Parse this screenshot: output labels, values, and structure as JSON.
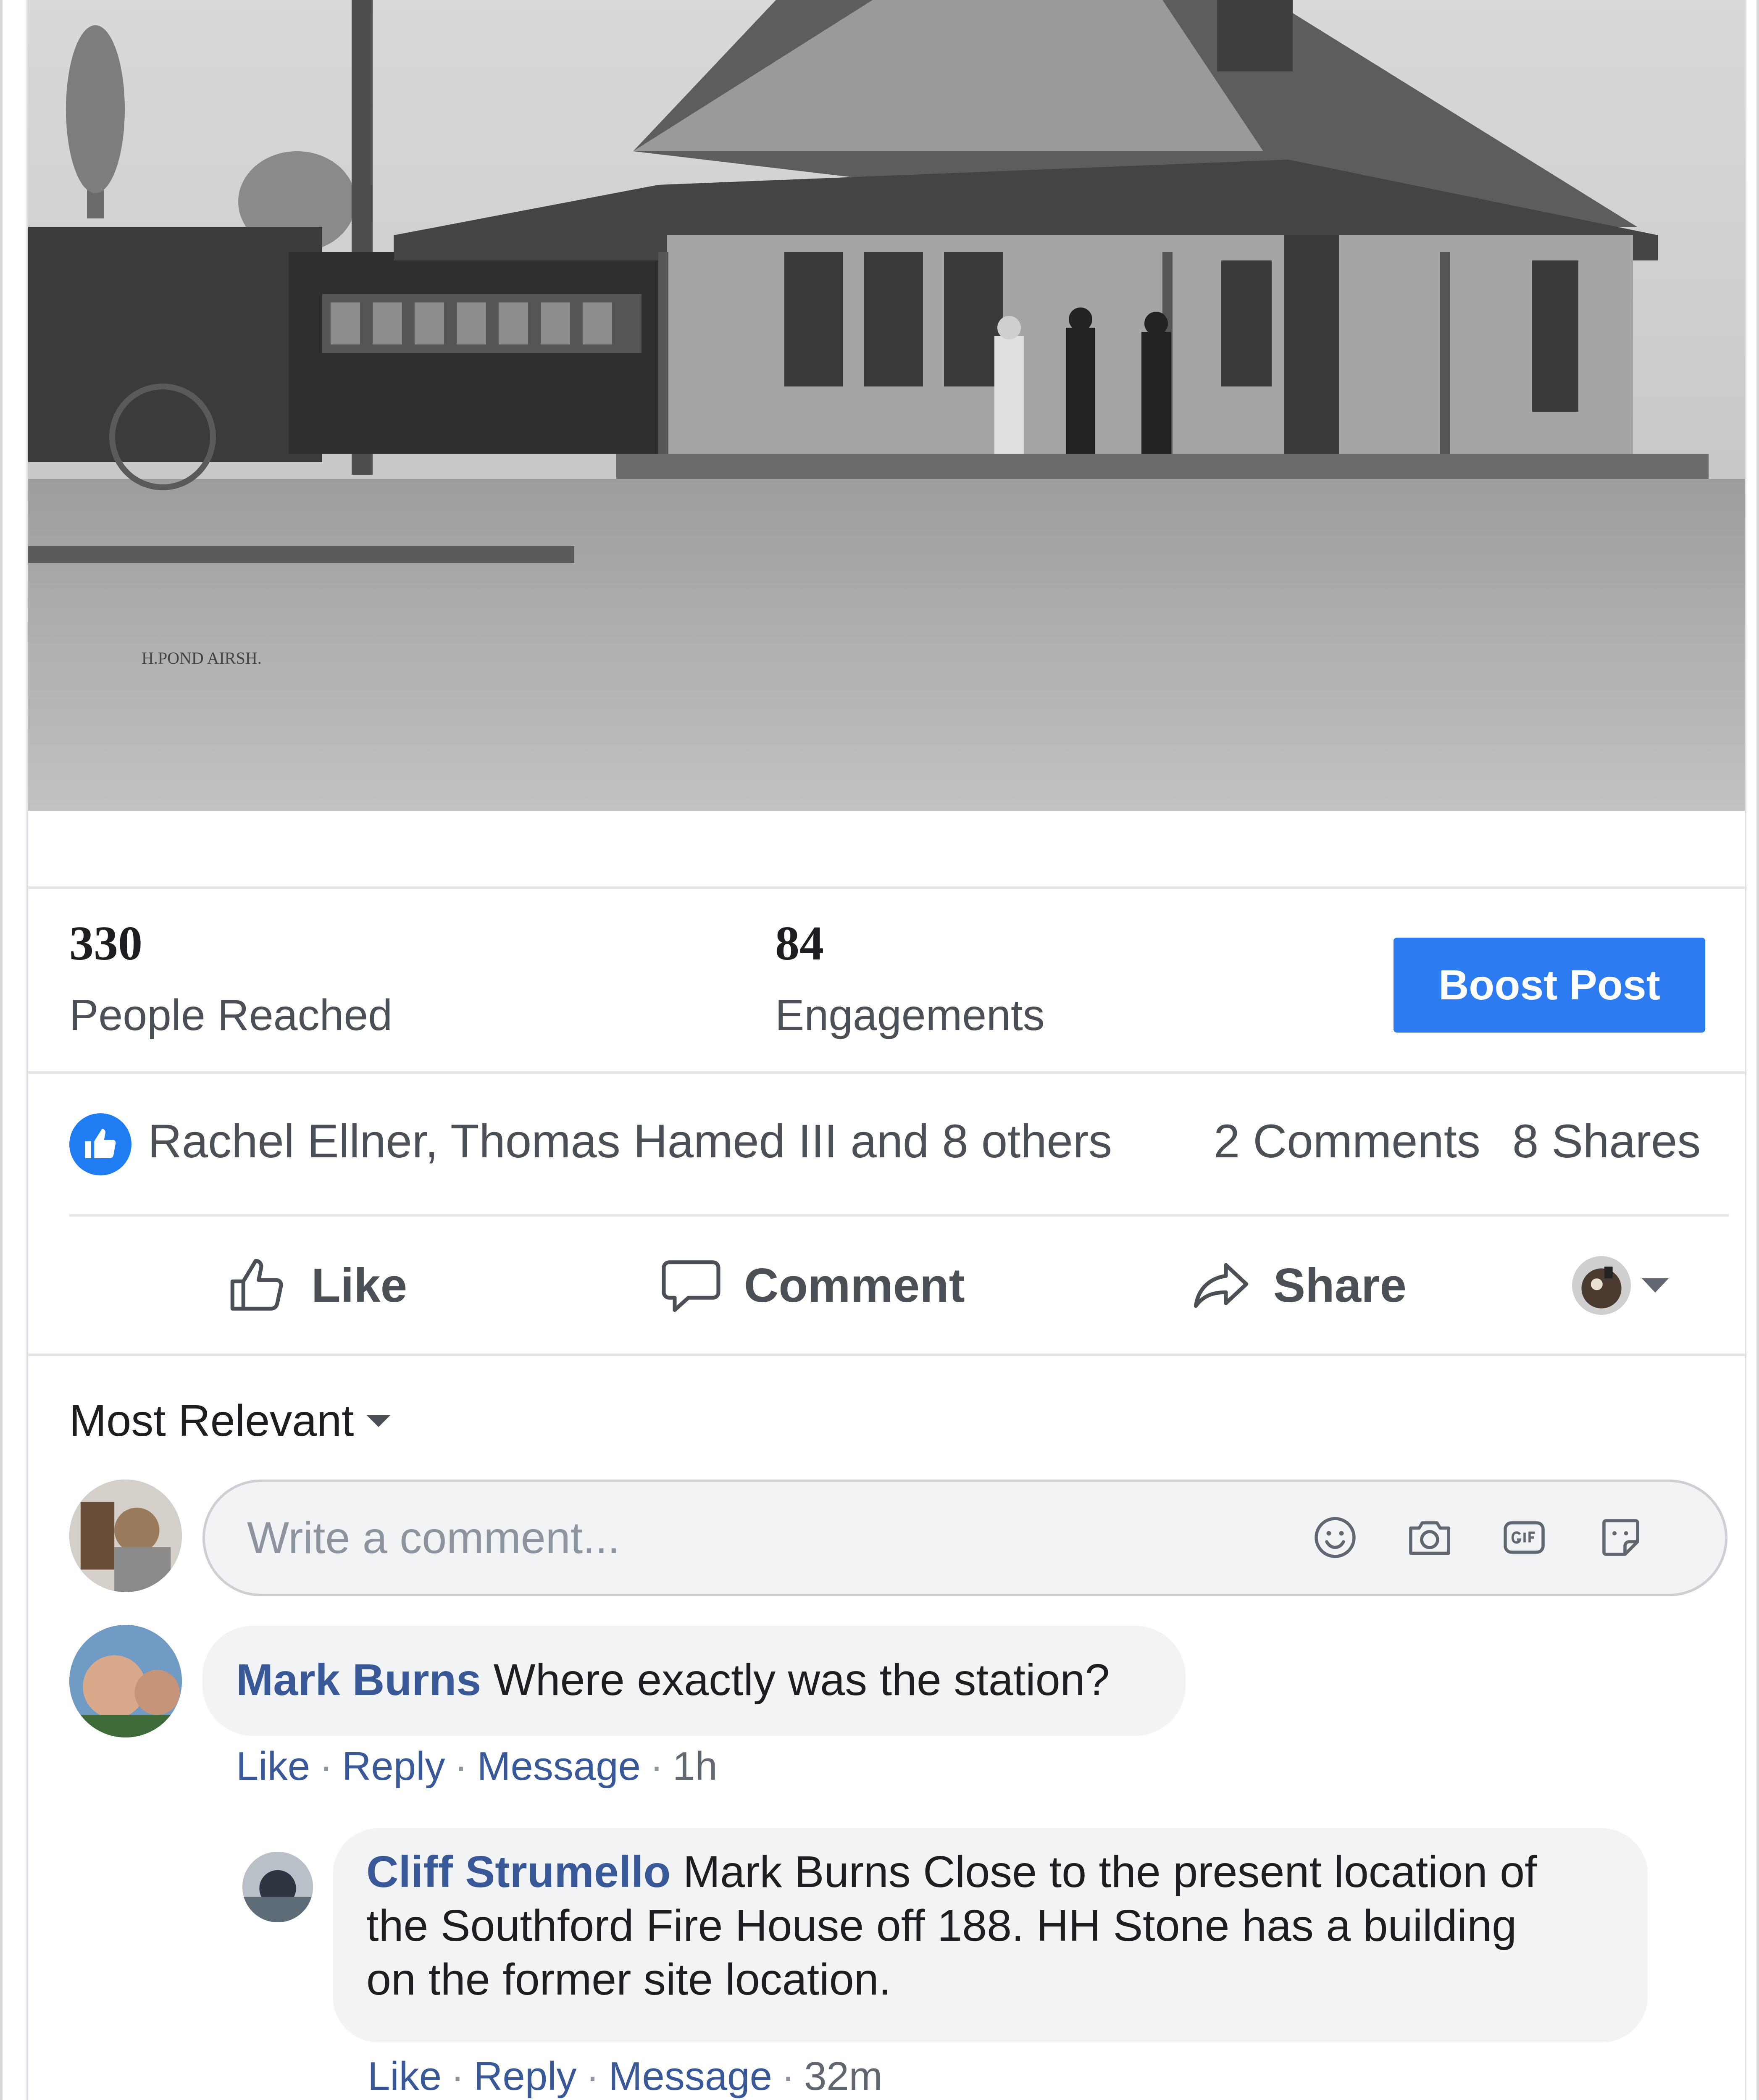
{
  "post": {
    "photo_alt": "Historic photograph of a railroad station with a trolley car and people on the platform",
    "photo_caption": "H.POND AIRSH."
  },
  "insights": {
    "reached": {
      "value": "330",
      "label": "People Reached"
    },
    "engagements": {
      "value": "84",
      "label": "Engagements"
    },
    "boost_label": "Boost Post"
  },
  "reactions": {
    "text": "Rachel Ellner, Thomas Hamed III and 8 others",
    "comments": "2 Comments",
    "shares": "8 Shares"
  },
  "actions": {
    "like": "Like",
    "comment": "Comment",
    "share": "Share"
  },
  "comments_section": {
    "sort_label": "Most Relevant",
    "input_placeholder": "Write a comment...",
    "comments": [
      {
        "author": "Mark Burns",
        "text": "Where exactly was the station?",
        "like": "Like",
        "reply": "Reply",
        "message": "Message",
        "time": "1h"
      }
    ],
    "replies": [
      {
        "author": "Cliff Strumello",
        "line1": "Mark Burns Close to the present location of",
        "line2": "the Southford Fire House off 188. HH Stone has a building",
        "line3": "on the former site location.",
        "like": "Like",
        "reply": "Reply",
        "message": "Message",
        "time": "32m"
      }
    ]
  },
  "colors": {
    "accent": "#2d7bf0",
    "link": "#385898",
    "muted": "#4b4f56"
  }
}
